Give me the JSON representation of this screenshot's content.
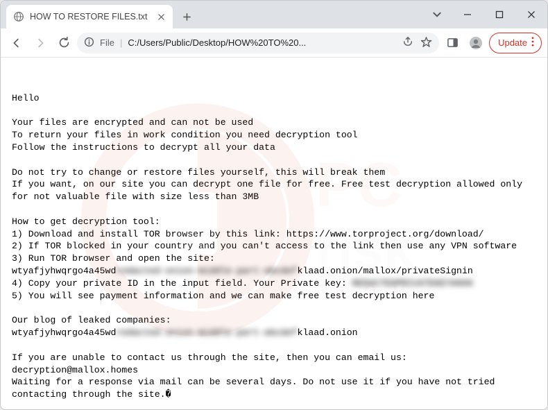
{
  "tab": {
    "title": "HOW TO RESTORE FILES.txt"
  },
  "toolbar": {
    "url_prefix": "File",
    "url_path": "C:/Users/Public/Desktop/HOW%20TO%20...",
    "update_label": "Update"
  },
  "body": {
    "p1": "Hello",
    "p2_l1": "Your files are encrypted and can not be used",
    "p2_l2": "To return your files in work condition you need decryption tool",
    "p2_l3": "Follow the instructions to decrypt all your data",
    "p3_l1": "Do not try to change or restore files yourself, this will break them",
    "p3_l2": "If you want, on our site you can decrypt one file for free. Free test decryption allowed only for not valuable file with size less than 3MB",
    "p4_l1": "How to get decryption tool:",
    "p4_l2": "1) Download and install TOR browser by this link: https://www.torproject.org/download/",
    "p4_l3": "2) If TOR blocked in your country and you can't access to the link then use any VPN software",
    "p4_l4": "3) Run TOR browser and open the site:",
    "p4_l5a": "wtyafjyhwqrgo4a45wd",
    "p4_l5b": "redacted-onion-middle-part-abcdef",
    "p4_l5c": "klaad.onion/mallox/privateSignin",
    "p4_l6a": "4) Copy your private ID in the input field. Your Private key: ",
    "p4_l6b": "REDACTEDPRIVATEKEY0000",
    "p4_l7": "5) You will see payment information and we can make free test decryption here",
    "p5_l1": "Our blog of leaked companies:",
    "p5_l2a": "wtyafjyhwqrgo4a45wd",
    "p5_l2b": "redacted-onion-middle-part-abcdef",
    "p5_l2c": "klaad.onion",
    "p6_l1": "If you are unable to contact us through the site, then you can email us:",
    "p6_l2": "decryption@mallox.homes",
    "p6_l3": "Waiting for a response via mail can be several days. Do not use it if you have not tried contacting through the site.�"
  }
}
